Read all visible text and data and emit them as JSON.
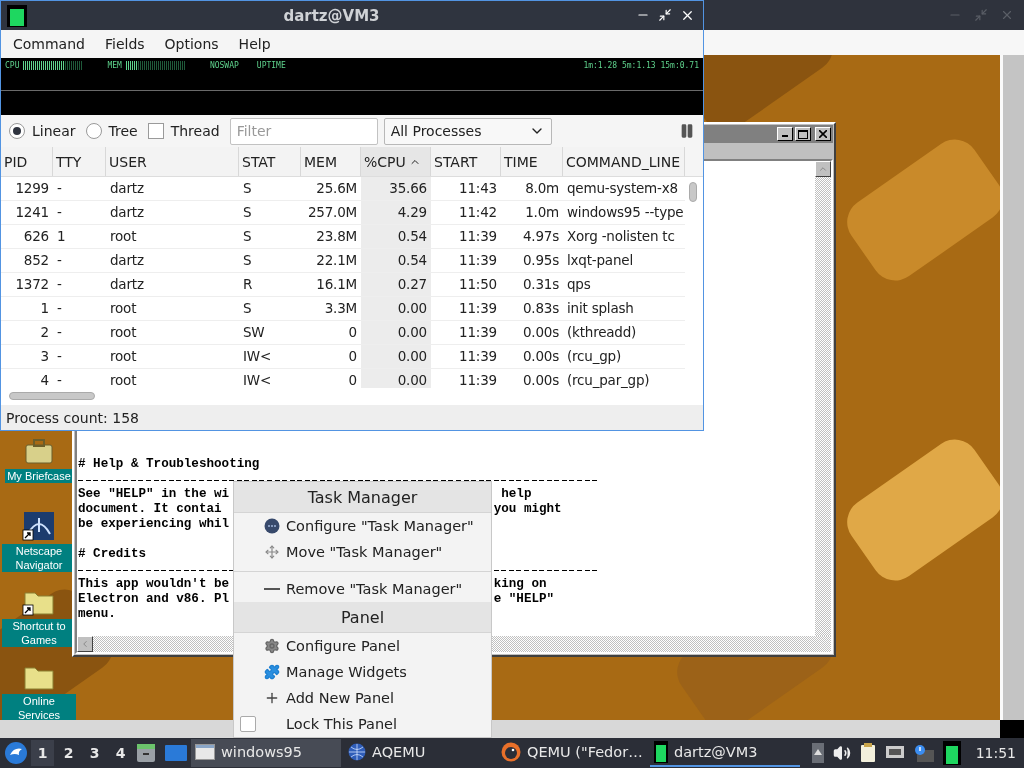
{
  "qps": {
    "title": "dartz@VM3",
    "menu": [
      "Command",
      "Fields",
      "Options",
      "Help"
    ],
    "graph": {
      "meters": [
        {
          "label": "CPU",
          "level": 0.7
        },
        {
          "label": "MEM",
          "level": 0.2
        }
      ],
      "labels": [
        "NOSWAP",
        "UPTIME"
      ],
      "load": "1m:1.28 5m:1.13 15m:0.71"
    },
    "view_modes": [
      {
        "label": "Linear",
        "selected": true
      },
      {
        "label": "Tree",
        "selected": false
      }
    ],
    "thread": {
      "label": "Thread",
      "checked": false
    },
    "filter": {
      "placeholder": "Filter"
    },
    "scope": {
      "value": "All Processes"
    },
    "columns": [
      {
        "label": "PID",
        "sorted": false
      },
      {
        "label": "TTY",
        "sorted": false
      },
      {
        "label": "USER",
        "sorted": false
      },
      {
        "label": "STAT",
        "sorted": false
      },
      {
        "label": "MEM",
        "sorted": false
      },
      {
        "label": "%CPU",
        "sorted": true
      },
      {
        "label": "START",
        "sorted": false
      },
      {
        "label": "TIME",
        "sorted": false
      },
      {
        "label": "COMMAND_LINE",
        "sorted": false
      }
    ],
    "rows": [
      [
        "1299",
        "-",
        "dartz",
        "S",
        "25.6M",
        "35.66",
        "11:43",
        "8.0m",
        "qemu-system-x8"
      ],
      [
        "1241",
        "-",
        "dartz",
        "S",
        "257.0M",
        "4.29",
        "11:42",
        "1.0m",
        "windows95 --type"
      ],
      [
        "626",
        "1",
        "root",
        "S",
        "23.8M",
        "0.54",
        "11:39",
        "4.97s",
        "Xorg -nolisten tc"
      ],
      [
        "852",
        "-",
        "dartz",
        "S",
        "22.1M",
        "0.54",
        "11:39",
        "0.95s",
        "lxqt-panel"
      ],
      [
        "1372",
        "-",
        "dartz",
        "R",
        "16.1M",
        "0.27",
        "11:50",
        "0.31s",
        "qps"
      ],
      [
        "1",
        "-",
        "root",
        "S",
        "3.3M",
        "0.00",
        "11:39",
        "0.83s",
        "init splash"
      ],
      [
        "2",
        "-",
        "root",
        "SW",
        "0",
        "0.00",
        "11:39",
        "0.00s",
        "(kthreadd)"
      ],
      [
        "3",
        "-",
        "root",
        "IW<",
        "0",
        "0.00",
        "11:39",
        "0.00s",
        "(rcu_gp)"
      ],
      [
        "4",
        "-",
        "root",
        "IW<",
        "0",
        "0.00",
        "11:39",
        "0.00s",
        "(rcu_par_gp)"
      ]
    ],
    "status": "Process count: 158"
  },
  "emulator": {
    "desktop_icons": [
      {
        "label": "My Briefcase",
        "kind": "briefcase",
        "shortcut": false
      },
      {
        "label": "Netscape Navigator",
        "kind": "netscape",
        "shortcut": true
      },
      {
        "label": "Shortcut to Games",
        "kind": "folder",
        "shortcut": true
      },
      {
        "label": "Online Services",
        "kind": "folder",
        "shortcut": false
      }
    ],
    "lines": [
      {
        "kind": "text",
        "left": "# Help & Troubleshooting"
      },
      {
        "kind": "rule"
      },
      {
        "kind": "text",
        "left": "See \"HELP\" in the wi",
        "right": " help"
      },
      {
        "kind": "text",
        "left": "document. It contai",
        "right": "you might"
      },
      {
        "kind": "text",
        "left": "be experiencing whil"
      },
      {
        "kind": "blank"
      },
      {
        "kind": "text",
        "left": "# Credits"
      },
      {
        "kind": "rule"
      },
      {
        "kind": "text",
        "left": "This app wouldn't be",
        "right": "king on"
      },
      {
        "kind": "text",
        "left": "Electron and v86. Pl",
        "right": "e \"HELP\""
      },
      {
        "kind": "text",
        "left": "menu."
      }
    ]
  },
  "context_menu": {
    "sections": [
      {
        "title": "Task Manager",
        "items": [
          {
            "kind": "configure",
            "label": "Configure \"Task Manager\""
          },
          {
            "kind": "move",
            "label": "Move \"Task Manager\""
          },
          {
            "kind": "separator"
          },
          {
            "kind": "remove",
            "label": "Remove \"Task Manager\""
          }
        ]
      },
      {
        "title": "Panel",
        "items": [
          {
            "kind": "settings",
            "label": "Configure Panel"
          },
          {
            "kind": "widgets",
            "label": "Manage Widgets"
          },
          {
            "kind": "add",
            "label": "Add New Panel"
          },
          {
            "kind": "lock",
            "label": "Lock This Panel",
            "checked": false
          }
        ]
      }
    ]
  },
  "taskbar": {
    "desktops": [
      {
        "label": "1",
        "selected": true
      },
      {
        "label": "2",
        "selected": false
      },
      {
        "label": "3",
        "selected": false
      },
      {
        "label": "4",
        "selected": false
      }
    ],
    "tasks": [
      {
        "kind": "win95",
        "label": "windows95",
        "selected": false,
        "hovered": true
      },
      {
        "kind": "aqemu",
        "label": "AQEMU",
        "selected": false,
        "hovered": false
      },
      {
        "kind": "qemu",
        "label": "QEMU (\"Fedor…",
        "selected": false,
        "hovered": false
      },
      {
        "kind": "terminal",
        "label": "dartz@VM3",
        "selected": true,
        "hovered": false
      }
    ],
    "clock": "11:51"
  }
}
